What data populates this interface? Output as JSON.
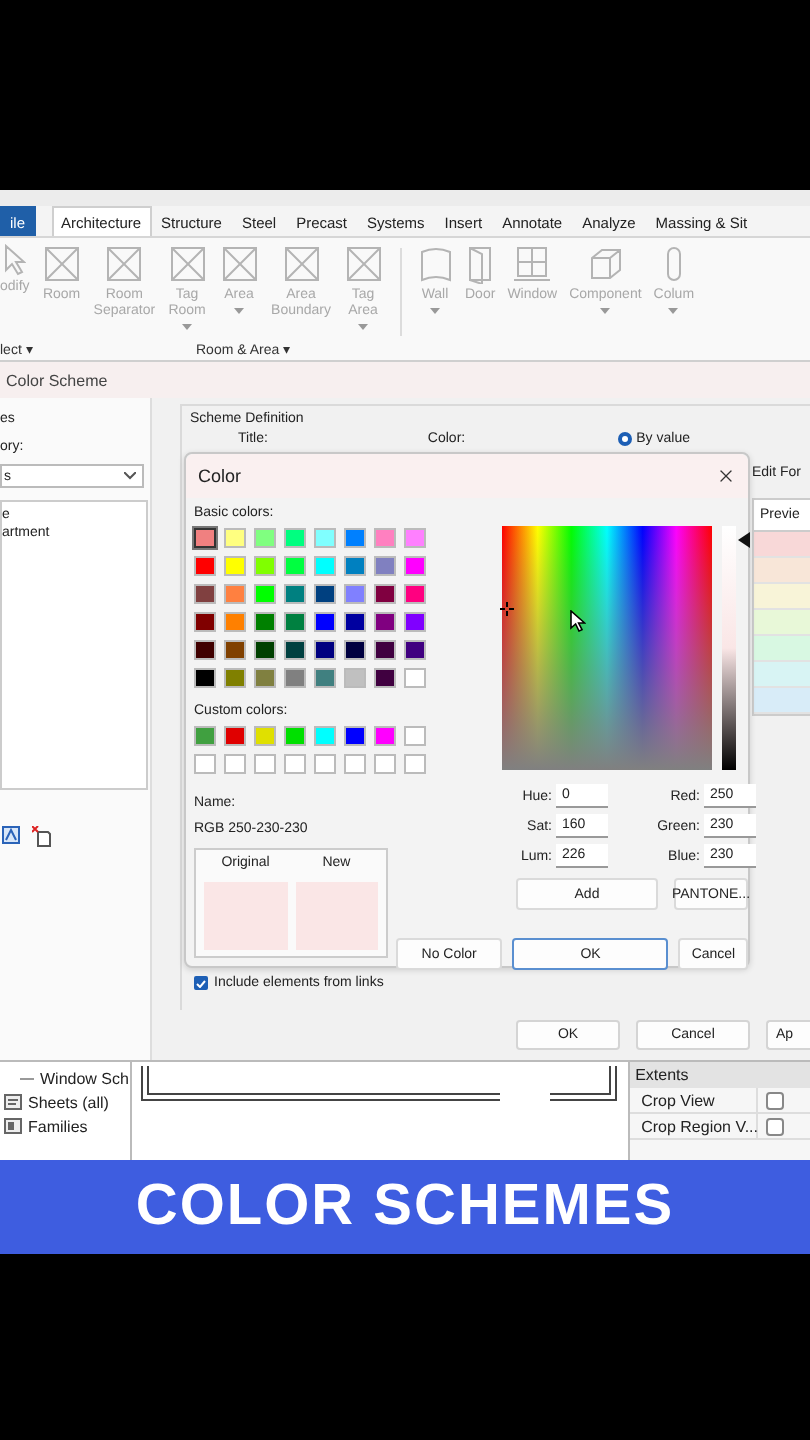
{
  "ribbon": {
    "tabs": [
      {
        "label": "ile",
        "kind": "application",
        "selected": false
      },
      {
        "label": "Architecture",
        "kind": "tab",
        "selected": true
      },
      {
        "label": "Structure",
        "kind": "tab",
        "selected": false
      },
      {
        "label": "Steel",
        "kind": "tab",
        "selected": false
      },
      {
        "label": "Precast",
        "kind": "tab",
        "selected": false
      },
      {
        "label": "Systems",
        "kind": "tab",
        "selected": false
      },
      {
        "label": "Insert",
        "kind": "tab",
        "selected": false
      },
      {
        "label": "Annotate",
        "kind": "tab",
        "selected": false
      },
      {
        "label": "Analyze",
        "kind": "tab",
        "selected": false
      },
      {
        "label": "Massing & Sit",
        "kind": "tab",
        "selected": false
      }
    ],
    "tools": [
      {
        "label": "odify",
        "dropdown": false,
        "disabled": true
      },
      {
        "label": "Room",
        "dropdown": false,
        "disabled": true
      },
      {
        "label": "Room Separator",
        "dropdown": false,
        "disabled": true
      },
      {
        "label": "Tag Room",
        "dropdown": true,
        "disabled": true
      },
      {
        "label": "Area",
        "dropdown": true,
        "disabled": true
      },
      {
        "label": "Area Boundary",
        "dropdown": false,
        "disabled": true
      },
      {
        "label": "Tag Area",
        "dropdown": true,
        "disabled": true
      },
      {
        "label": "Wall",
        "dropdown": true,
        "disabled": true
      },
      {
        "label": "Door",
        "dropdown": false,
        "disabled": true
      },
      {
        "label": "Window",
        "dropdown": false,
        "disabled": true
      },
      {
        "label": "Component",
        "dropdown": true,
        "disabled": true
      },
      {
        "label": "Colum",
        "dropdown": true,
        "disabled": true
      }
    ],
    "panels": [
      "lect ▾",
      "Room & Area ▾"
    ]
  },
  "color_scheme_dialog": {
    "title": "Color Scheme",
    "schemes_heading": "es",
    "category_label": "ory:",
    "category_value": "s",
    "schemes": [
      "e",
      "artment"
    ],
    "definition_heading": "Scheme Definition",
    "title_label": "Title:",
    "color_label": "Color:",
    "by_value": {
      "label": "By value",
      "selected": true
    },
    "edit_format": "Edit For",
    "preview_header": "Previe",
    "preview_rows": [
      {
        "color": "#f8d8d8"
      },
      {
        "color": "#f8e6d8"
      },
      {
        "color": "#f8f4d8"
      },
      {
        "color": "#e8f8d8"
      },
      {
        "color": "#d8f8e2"
      },
      {
        "color": "#d8f4f4"
      },
      {
        "color": "#d8ecf8"
      }
    ],
    "include_links": {
      "label": "Include elements from links",
      "checked": true
    },
    "buttons": [
      "OK",
      "Cancel",
      "Ap"
    ]
  },
  "color_dialog": {
    "title": "Color",
    "basic_colors_label": "Basic colors:",
    "basic_colors": [
      {
        "color": "#f08080",
        "selected": true
      },
      {
        "color": "#ffff80",
        "selected": false
      },
      {
        "color": "#80ff80",
        "selected": false
      },
      {
        "color": "#00ff80",
        "selected": false
      },
      {
        "color": "#80ffff",
        "selected": false
      },
      {
        "color": "#0080ff",
        "selected": false
      },
      {
        "color": "#ff80c0",
        "selected": false
      },
      {
        "color": "#ff80ff",
        "selected": false
      },
      {
        "color": "#ff0000",
        "selected": false
      },
      {
        "color": "#ffff00",
        "selected": false
      },
      {
        "color": "#80ff00",
        "selected": false
      },
      {
        "color": "#00ff40",
        "selected": false
      },
      {
        "color": "#00ffff",
        "selected": false
      },
      {
        "color": "#0080c0",
        "selected": false
      },
      {
        "color": "#8080c0",
        "selected": false
      },
      {
        "color": "#ff00ff",
        "selected": false
      },
      {
        "color": "#804040",
        "selected": false
      },
      {
        "color": "#ff8040",
        "selected": false
      },
      {
        "color": "#00ff00",
        "selected": false
      },
      {
        "color": "#008080",
        "selected": false
      },
      {
        "color": "#004080",
        "selected": false
      },
      {
        "color": "#8080ff",
        "selected": false
      },
      {
        "color": "#800040",
        "selected": false
      },
      {
        "color": "#ff0080",
        "selected": false
      },
      {
        "color": "#800000",
        "selected": false
      },
      {
        "color": "#ff8000",
        "selected": false
      },
      {
        "color": "#008000",
        "selected": false
      },
      {
        "color": "#008040",
        "selected": false
      },
      {
        "color": "#0000ff",
        "selected": false
      },
      {
        "color": "#0000a0",
        "selected": false
      },
      {
        "color": "#800080",
        "selected": false
      },
      {
        "color": "#8000ff",
        "selected": false
      },
      {
        "color": "#400000",
        "selected": false
      },
      {
        "color": "#804000",
        "selected": false
      },
      {
        "color": "#004000",
        "selected": false
      },
      {
        "color": "#004040",
        "selected": false
      },
      {
        "color": "#000080",
        "selected": false
      },
      {
        "color": "#000040",
        "selected": false
      },
      {
        "color": "#400040",
        "selected": false
      },
      {
        "color": "#400080",
        "selected": false
      },
      {
        "color": "#000000",
        "selected": false
      },
      {
        "color": "#808000",
        "selected": false
      },
      {
        "color": "#808040",
        "selected": false
      },
      {
        "color": "#808080",
        "selected": false
      },
      {
        "color": "#408080",
        "selected": false
      },
      {
        "color": "#c0c0c0",
        "selected": false
      },
      {
        "color": "#400040",
        "selected": false
      },
      {
        "color": "#ffffff",
        "selected": false
      }
    ],
    "custom_colors_label": "Custom colors:",
    "custom_colors": [
      {
        "color": "#40a040"
      },
      {
        "color": "#e00000"
      },
      {
        "color": "#e0e000"
      },
      {
        "color": "#00e000"
      },
      {
        "color": "#00ffff"
      },
      {
        "color": "#0000ff"
      },
      {
        "color": "#ff00ff"
      },
      {
        "color": "#ffffff"
      },
      {
        "color": "#ffffff"
      },
      {
        "color": "#ffffff"
      },
      {
        "color": "#ffffff"
      },
      {
        "color": "#ffffff"
      },
      {
        "color": "#ffffff"
      },
      {
        "color": "#ffffff"
      },
      {
        "color": "#ffffff"
      },
      {
        "color": "#ffffff"
      }
    ],
    "name_label": "Name:",
    "name_value": "RGB 250-230-230",
    "original_label": "Original",
    "new_label": "New",
    "hsl_fields": [
      {
        "label": "Hue:",
        "value": "0"
      },
      {
        "label": "Sat:",
        "value": "160"
      },
      {
        "label": "Lum:",
        "value": "226"
      }
    ],
    "rgb_fields": [
      {
        "label": "Red:",
        "value": "250"
      },
      {
        "label": "Green:",
        "value": "230"
      },
      {
        "label": "Blue:",
        "value": "230"
      }
    ],
    "add_button": "Add",
    "pantone_button": "PANTONE...",
    "buttons": [
      {
        "label": "No Color",
        "default": false
      },
      {
        "label": "OK",
        "default": true
      },
      {
        "label": "Cancel",
        "default": false
      }
    ]
  },
  "project_browser": [
    {
      "label": "Window Sch",
      "kind": "view"
    },
    {
      "label": "Sheets (all)",
      "kind": "sheets"
    },
    {
      "label": "Families",
      "kind": "families"
    }
  ],
  "properties": {
    "section": "Extents",
    "rows": [
      {
        "label": "Crop View",
        "checked": false
      },
      {
        "label": "Crop Region V...",
        "checked": false
      }
    ]
  },
  "banner": "COLOR SCHEMES"
}
